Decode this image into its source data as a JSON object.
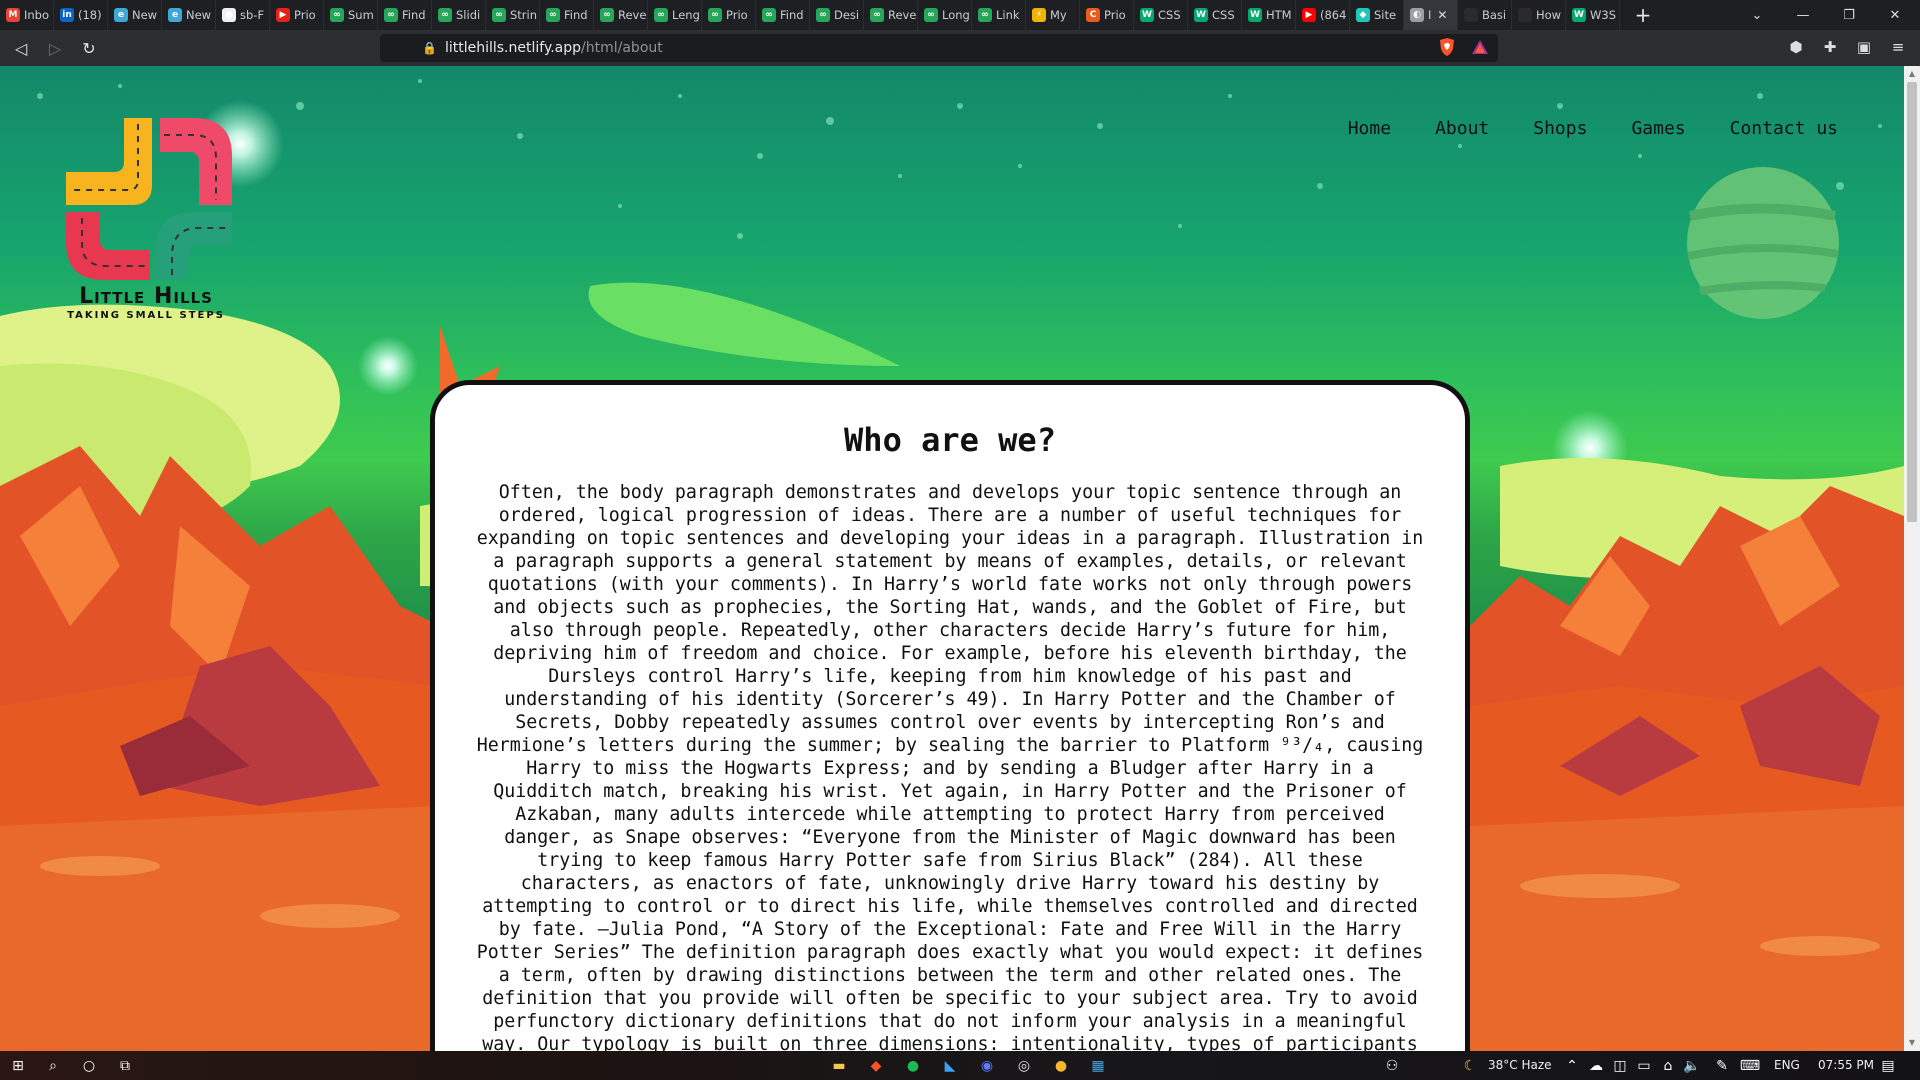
{
  "browser": {
    "tabs": [
      {
        "label": "Inbo",
        "icon": "gmail-icon",
        "color": "#ea4335",
        "glyph": "M"
      },
      {
        "label": "(18)",
        "icon": "linkedin-icon",
        "color": "#0a66c2",
        "glyph": "in"
      },
      {
        "label": "New",
        "icon": "edge-icon",
        "color": "#3fa7d6",
        "glyph": "e"
      },
      {
        "label": "New",
        "icon": "edge-icon",
        "color": "#3fa7d6",
        "glyph": "e"
      },
      {
        "label": "sb-F",
        "icon": "github-icon",
        "color": "#f0f0f0",
        "glyph": "●"
      },
      {
        "label": "Prio",
        "icon": "youtube-icon",
        "color": "#e62117",
        "glyph": "▶"
      },
      {
        "label": "Sum",
        "icon": "infinity-icon",
        "color": "#26a65b",
        "glyph": "∞"
      },
      {
        "label": "Find",
        "icon": "infinity-icon",
        "color": "#26a65b",
        "glyph": "∞"
      },
      {
        "label": "Slidi",
        "icon": "infinity-icon",
        "color": "#26a65b",
        "glyph": "∞"
      },
      {
        "label": "Strin",
        "icon": "infinity-icon",
        "color": "#26a65b",
        "glyph": "∞"
      },
      {
        "label": "Find",
        "icon": "infinity-icon",
        "color": "#26a65b",
        "glyph": "∞"
      },
      {
        "label": "Reve",
        "icon": "infinity-icon",
        "color": "#26a65b",
        "glyph": "∞"
      },
      {
        "label": "Leng",
        "icon": "infinity-icon",
        "color": "#26a65b",
        "glyph": "∞"
      },
      {
        "label": "Prio",
        "icon": "infinity-icon",
        "color": "#26a65b",
        "glyph": "∞"
      },
      {
        "label": "Find",
        "icon": "infinity-icon",
        "color": "#26a65b",
        "glyph": "∞"
      },
      {
        "label": "Desi",
        "icon": "infinity-icon",
        "color": "#26a65b",
        "glyph": "∞"
      },
      {
        "label": "Reve",
        "icon": "infinity-icon",
        "color": "#26a65b",
        "glyph": "∞"
      },
      {
        "label": "Long",
        "icon": "infinity-icon",
        "color": "#26a65b",
        "glyph": "∞"
      },
      {
        "label": "Link",
        "icon": "infinity-icon",
        "color": "#26a65b",
        "glyph": "∞"
      },
      {
        "label": "My",
        "icon": "lightning-icon",
        "color": "#f0b400",
        "glyph": "⚡"
      },
      {
        "label": "Prio",
        "icon": "cs-icon",
        "color": "#e85d1f",
        "glyph": "C"
      },
      {
        "label": "CSS",
        "icon": "w3schools-icon",
        "color": "#04aa6d",
        "glyph": "W"
      },
      {
        "label": "CSS",
        "icon": "w3schools-icon",
        "color": "#04aa6d",
        "glyph": "W"
      },
      {
        "label": "HTM",
        "icon": "w3schools-icon",
        "color": "#04aa6d",
        "glyph": "W"
      },
      {
        "label": "(864",
        "icon": "youtube-icon",
        "color": "#ff0000",
        "glyph": "▶"
      },
      {
        "label": "Site",
        "icon": "netlify-icon",
        "color": "#20c6b7",
        "glyph": "◆"
      },
      {
        "label": "I",
        "icon": "globe-icon",
        "color": "#9aa0a6",
        "glyph": "◐",
        "active": true
      },
      {
        "label": "Basi",
        "icon": "blank-icon",
        "color": "#2a2a2a",
        "glyph": ""
      },
      {
        "label": "How",
        "icon": "github-icon",
        "color": "#2a2a2a",
        "glyph": ""
      },
      {
        "label": "W3S",
        "icon": "w3schools-icon",
        "color": "#04aa6d",
        "glyph": "W"
      }
    ],
    "url": {
      "host": "littlehills.netlify.app",
      "path": "/html/about"
    }
  },
  "site": {
    "logo": {
      "title": "Little Hills",
      "subtitle": "TAKING SMALL STEPS"
    },
    "nav": [
      {
        "label": "Home"
      },
      {
        "label": "About"
      },
      {
        "label": "Shops"
      },
      {
        "label": "Games"
      },
      {
        "label": "Contact us"
      }
    ],
    "about": {
      "heading": "Who are we?",
      "body": "Often, the body paragraph demonstrates and develops your topic sentence through an ordered, logical progression of ideas. There are a number of useful techniques for expanding on topic sentences and developing your ideas in a paragraph. Illustration in a paragraph supports a general statement by means of examples, details, or relevant quotations (with your comments). In Harry’s world fate works not only through powers and objects such as prophecies, the Sorting Hat, wands, and the Goblet of Fire, but also through people. Repeatedly, other characters decide Harry’s future for him, depriving him of freedom and choice. For example, before his eleventh birthday, the Dursleys control Harry’s life, keeping from him knowledge of his past and understanding of his identity (Sorcerer’s 49). In Harry Potter and the Chamber of Secrets, Dobby repeatedly assumes control over events by intercepting Ron’s and Hermione’s letters during the summer; by sealing the barrier to Platform ⁹³/₄, causing Harry to miss the Hogwarts Express; and by sending a Bludger after Harry in a Quidditch match, breaking his wrist. Yet again, in Harry Potter and the Prisoner of Azkaban, many adults intercede while attempting to protect Harry from perceived danger, as Snape observes: “Everyone from the Minister of Magic downward has been trying to keep famous Harry Potter safe from Sirius Black” (284). All these characters, as enactors of fate, unknowingly drive Harry toward his destiny by attempting to control or to direct his life, while themselves controlled and directed by fate. —Julia Pond, “A Story of the Exceptional: Fate and Free Will in the Harry Potter Series” The definition paragraph does exactly what you would expect: it defines a term, often by drawing distinctions between the term and other related ones. The definition that you provide will often be specific to your subject area. Try to avoid perfunctory dictionary definitions that do not inform your analysis in a meaningful way. Our typology is built on three dimensions: intentionality, types of participants"
    }
  },
  "taskbar": {
    "weather": "38°C  Haze",
    "language": "ENG",
    "time": "07:55 PM"
  }
}
